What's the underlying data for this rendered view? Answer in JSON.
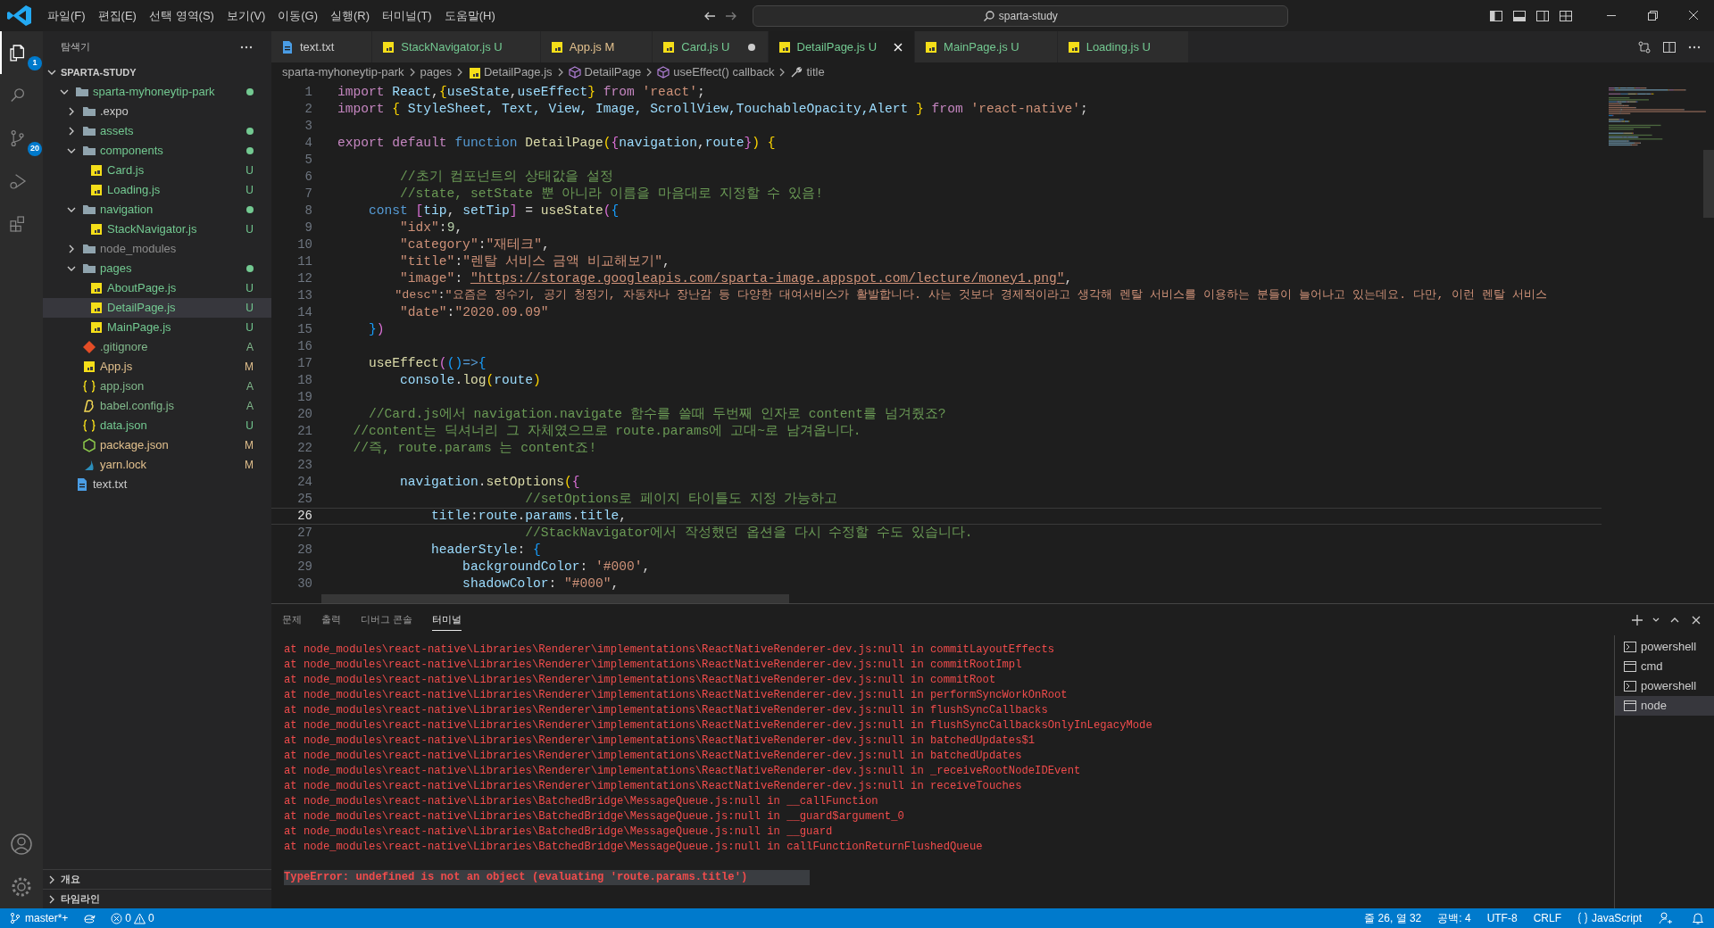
{
  "title_bar": {
    "menus": [
      "파일(F)",
      "편집(E)",
      "선택 영역(S)",
      "보기(V)",
      "이동(G)",
      "실행(R)",
      "터미널(T)",
      "도움말(H)"
    ],
    "search": "sparta-study"
  },
  "activity_bar": [
    {
      "kind": "explorer",
      "selected": true,
      "badge": "1"
    },
    {
      "kind": "search",
      "selected": false
    },
    {
      "kind": "scm",
      "selected": false,
      "badge": "20"
    },
    {
      "kind": "debug",
      "selected": false
    },
    {
      "kind": "extensions",
      "selected": false
    }
  ],
  "sidebar": {
    "title": "탐색기",
    "section": "SPARTA-STUDY",
    "tree": [
      {
        "name": "sparta-myhoneytip-park",
        "kind": "folder",
        "expanded": true,
        "color": "#73c991",
        "dot": true,
        "selected": false,
        "children": [
          {
            "name": ".expo",
            "kind": "folder",
            "expanded": false,
            "dot": false,
            "selected": false
          },
          {
            "name": "assets",
            "kind": "folder",
            "expanded": false,
            "color": "#73c991",
            "dot": true,
            "selected": false
          },
          {
            "name": "components",
            "kind": "folder",
            "expanded": true,
            "color": "#73c991",
            "dot": true,
            "selected": false,
            "children": [
              {
                "name": "Card.js",
                "kind": "js",
                "color": "#73c991",
                "status": "U",
                "selected": false
              },
              {
                "name": "Loading.js",
                "kind": "js",
                "color": "#73c991",
                "status": "U",
                "selected": false
              }
            ]
          },
          {
            "name": "navigation",
            "kind": "folder",
            "expanded": true,
            "color": "#73c991",
            "dot": true,
            "selected": false,
            "children": [
              {
                "name": "StackNavigator.js",
                "kind": "js",
                "color": "#73c991",
                "status": "U",
                "selected": false
              }
            ]
          },
          {
            "name": "node_modules",
            "kind": "folder",
            "expanded": false,
            "color": "#8c8c8c",
            "dot": false,
            "selected": false
          },
          {
            "name": "pages",
            "kind": "folder",
            "expanded": true,
            "color": "#73c991",
            "dot": true,
            "selected": false,
            "children": [
              {
                "name": "AboutPage.js",
                "kind": "js",
                "color": "#73c991",
                "status": "U",
                "selected": false
              },
              {
                "name": "DetailPage.js",
                "kind": "js",
                "color": "#73c991",
                "status": "U",
                "selected": true
              },
              {
                "name": "MainPage.js",
                "kind": "js",
                "color": "#73c991",
                "status": "U",
                "selected": false
              }
            ]
          },
          {
            "name": ".gitignore",
            "kind": "git",
            "color": "#81b88b",
            "status": "A",
            "selected": false
          },
          {
            "name": "App.js",
            "kind": "js",
            "color": "#e2c08d",
            "status": "M",
            "selected": false
          },
          {
            "name": "app.json",
            "kind": "json",
            "color": "#81b88b",
            "status": "A",
            "selected": false
          },
          {
            "name": "babel.config.js",
            "kind": "babel",
            "color": "#81b88b",
            "status": "A",
            "selected": false
          },
          {
            "name": "data.json",
            "kind": "json",
            "color": "#73c991",
            "status": "U",
            "selected": false
          },
          {
            "name": "package.json",
            "kind": "npm",
            "color": "#e2c08d",
            "status": "M",
            "selected": false
          },
          {
            "name": "yarn.lock",
            "kind": "yarn",
            "color": "#e2c08d",
            "status": "M",
            "selected": false
          }
        ]
      },
      {
        "name": "text.txt",
        "kind": "txt",
        "selected": false
      }
    ],
    "bottom_sections": [
      "개요",
      "타임라인"
    ]
  },
  "tabs": [
    {
      "label": "text.txt",
      "kind": "txt",
      "selected": false,
      "dirty": false
    },
    {
      "label": "StackNavigator.js",
      "kind": "js",
      "color": "#73c991",
      "status": "U",
      "selected": false,
      "dirty": false
    },
    {
      "label": "App.js",
      "kind": "js",
      "color": "#e2c08d",
      "status": "M",
      "selected": false,
      "dirty": false
    },
    {
      "label": "Card.js",
      "kind": "js",
      "color": "#73c991",
      "status": "U",
      "selected": false,
      "dirty": true
    },
    {
      "label": "DetailPage.js",
      "kind": "js",
      "color": "#73c991",
      "status": "U",
      "selected": true,
      "dirty": false
    },
    {
      "label": "MainPage.js",
      "kind": "js",
      "color": "#73c991",
      "status": "U",
      "selected": false,
      "dirty": false
    },
    {
      "label": "Loading.js",
      "kind": "js",
      "color": "#73c991",
      "status": "U",
      "selected": false,
      "dirty": false
    }
  ],
  "breadcrumb": [
    {
      "label": "sparta-myhoneytip-park",
      "kind": "folder"
    },
    {
      "label": "pages",
      "kind": "folder"
    },
    {
      "label": "DetailPage.js",
      "kind": "js"
    },
    {
      "label": "DetailPage",
      "kind": "symbol"
    },
    {
      "label": "useEffect() callback",
      "kind": "symbol"
    },
    {
      "label": "title",
      "kind": "property"
    }
  ],
  "editor": {
    "lines": [
      {
        "number": "1",
        "current": false,
        "segments": [
          {
            "text": "import ",
            "kind": "keyword"
          },
          {
            "text": "React",
            "kind": "variable"
          },
          {
            "text": ",",
            "kind": "punctuation"
          },
          {
            "text": "{",
            "kind": "bracket1"
          },
          {
            "text": "useState",
            "kind": "variable"
          },
          {
            "text": ",",
            "kind": "punctuation"
          },
          {
            "text": "useEffect",
            "kind": "variable"
          },
          {
            "text": "}",
            "kind": "bracket1"
          },
          {
            "text": " from ",
            "kind": "keyword"
          },
          {
            "text": "'react'",
            "kind": "string"
          },
          {
            "text": ";",
            "kind": "punctuation"
          }
        ]
      },
      {
        "number": "2",
        "current": false,
        "segments": [
          {
            "text": "import ",
            "kind": "keyword"
          },
          {
            "text": "{",
            "kind": "bracket1"
          },
          {
            "text": " StyleSheet, Text, View, Image, ScrollView,TouchableOpacity,Alert ",
            "kind": "variable"
          },
          {
            "text": "}",
            "kind": "bracket1"
          },
          {
            "text": " from ",
            "kind": "keyword"
          },
          {
            "text": "'react-native'",
            "kind": "string"
          },
          {
            "text": ";",
            "kind": "punctuation"
          }
        ]
      },
      {
        "number": "3",
        "current": false
      },
      {
        "number": "4",
        "current": false,
        "segments": [
          {
            "text": "export default ",
            "kind": "keyword"
          },
          {
            "text": "function ",
            "kind": "storage"
          },
          {
            "text": "DetailPage",
            "kind": "function"
          },
          {
            "text": "(",
            "kind": "bracket1"
          },
          {
            "text": "{",
            "kind": "bracket2"
          },
          {
            "text": "navigation",
            "kind": "variable"
          },
          {
            "text": ",",
            "kind": "punctuation"
          },
          {
            "text": "route",
            "kind": "variable"
          },
          {
            "text": "}",
            "kind": "bracket2"
          },
          {
            "text": ")",
            "kind": "bracket1"
          },
          {
            "text": " {",
            "kind": "bracket1"
          }
        ]
      },
      {
        "number": "5",
        "current": false
      },
      {
        "number": "6",
        "current": false,
        "segments": [
          {
            "text": "        //초기 컴포넌트의 상태값을 설정",
            "kind": "comment"
          }
        ]
      },
      {
        "number": "7",
        "current": false,
        "segments": [
          {
            "text": "        //state, setState 뿐 아니라 이름을 마음대로 지정할 수 있음!",
            "kind": "comment"
          }
        ]
      },
      {
        "number": "8",
        "current": false,
        "segments": [
          {
            "text": "    const ",
            "kind": "storage"
          },
          {
            "text": "[",
            "kind": "bracket2"
          },
          {
            "text": "tip",
            "kind": "variable"
          },
          {
            "text": ", ",
            "kind": "punctuation"
          },
          {
            "text": "setTip",
            "kind": "variable"
          },
          {
            "text": "]",
            "kind": "bracket2"
          },
          {
            "text": " = ",
            "kind": "punctuation"
          },
          {
            "text": "useState",
            "kind": "function"
          },
          {
            "text": "(",
            "kind": "bracket2"
          },
          {
            "text": "{",
            "kind": "bracket3"
          }
        ]
      },
      {
        "number": "9",
        "current": false,
        "segments": [
          {
            "text": "        \"idx\"",
            "kind": "string"
          },
          {
            "text": ":",
            "kind": "punctuation"
          },
          {
            "text": "9",
            "kind": "number"
          },
          {
            "text": ",",
            "kind": "punctuation"
          }
        ]
      },
      {
        "number": "10",
        "current": false,
        "segments": [
          {
            "text": "        \"category\"",
            "kind": "string"
          },
          {
            "text": ":",
            "kind": "punctuation"
          },
          {
            "text": "\"재테크\"",
            "kind": "string"
          },
          {
            "text": ",",
            "kind": "punctuation"
          }
        ]
      },
      {
        "number": "11",
        "current": false,
        "segments": [
          {
            "text": "        \"title\"",
            "kind": "string"
          },
          {
            "text": ":",
            "kind": "punctuation"
          },
          {
            "text": "\"렌탈 서비스 금액 비교해보기\"",
            "kind": "string"
          },
          {
            "text": ",",
            "kind": "punctuation"
          }
        ]
      },
      {
        "number": "12",
        "current": false,
        "segments": [
          {
            "text": "        \"image\"",
            "kind": "string"
          },
          {
            "text": ": ",
            "kind": "punctuation"
          },
          {
            "text": "\"https://storage.googleapis.com/sparta-image.appspot.com/lecture/money1.png\"",
            "kind": "link"
          },
          {
            "text": ",",
            "kind": "punctuation"
          }
        ]
      },
      {
        "number": "13",
        "current": false,
        "segments": [
          {
            "text": "        \"desc\"",
            "kind": "string"
          },
          {
            "text": ":",
            "kind": "punctuation"
          },
          {
            "text": "\"요즘은 정수기, 공기 청정기, 자동차나 장난감 등 다양한 대여서비스가 활발합니다. 사는 것보다 경제적이라고 생각해 렌탈 서비스를 이용하는 분들이 늘어나고 있는데요. 다만, 이런 렌탈 서비스",
            "kind": "string"
          }
        ]
      },
      {
        "number": "14",
        "current": false,
        "segments": [
          {
            "text": "        \"date\"",
            "kind": "string"
          },
          {
            "text": ":",
            "kind": "punctuation"
          },
          {
            "text": "\"2020.09.09\"",
            "kind": "string"
          }
        ]
      },
      {
        "number": "15",
        "current": false,
        "segments": [
          {
            "text": "    }",
            "kind": "bracket3"
          },
          {
            "text": ")",
            "kind": "bracket2"
          }
        ]
      },
      {
        "number": "16",
        "current": false
      },
      {
        "number": "17",
        "current": false,
        "segments": [
          {
            "text": "    useEffect",
            "kind": "function"
          },
          {
            "text": "(",
            "kind": "bracket2"
          },
          {
            "text": "()",
            "kind": "bracket3"
          },
          {
            "text": "=>",
            "kind": "storage"
          },
          {
            "text": "{",
            "kind": "bracket3"
          }
        ]
      },
      {
        "number": "18",
        "current": false,
        "segments": [
          {
            "text": "        console",
            "kind": "variable"
          },
          {
            "text": ".",
            "kind": "punctuation"
          },
          {
            "text": "log",
            "kind": "function"
          },
          {
            "text": "(",
            "kind": "bracket1"
          },
          {
            "text": "route",
            "kind": "variable"
          },
          {
            "text": ")",
            "kind": "bracket1"
          }
        ]
      },
      {
        "number": "19",
        "current": false
      },
      {
        "number": "20",
        "current": false,
        "segments": [
          {
            "text": "    //Card.js에서 navigation.navigate 함수를 쓸때 두번째 인자로 content를 넘겨줬죠?",
            "kind": "comment"
          }
        ]
      },
      {
        "number": "21",
        "current": false,
        "segments": [
          {
            "text": "  //content는 딕셔너리 그 자체였으므로 route.params에 고대~로 남겨옵니다.",
            "kind": "comment"
          }
        ]
      },
      {
        "number": "22",
        "current": false,
        "segments": [
          {
            "text": "  //즉, route.params 는 content죠!",
            "kind": "comment"
          }
        ]
      },
      {
        "number": "23",
        "current": false
      },
      {
        "number": "24",
        "current": false,
        "segments": [
          {
            "text": "        navigation",
            "kind": "variable"
          },
          {
            "text": ".",
            "kind": "punctuation"
          },
          {
            "text": "setOptions",
            "kind": "function"
          },
          {
            "text": "(",
            "kind": "bracket1"
          },
          {
            "text": "{",
            "kind": "bracket2"
          }
        ]
      },
      {
        "number": "25",
        "current": false,
        "segments": [
          {
            "text": "                        //setOptions로 페이지 타이틀도 지정 가능하고",
            "kind": "comment"
          }
        ]
      },
      {
        "number": "26",
        "current": true,
        "segments": [
          {
            "text": "            title",
            "kind": "variable"
          },
          {
            "text": ":",
            "kind": "punctuation"
          },
          {
            "text": "route",
            "kind": "variable"
          },
          {
            "text": ".",
            "kind": "punctuation"
          },
          {
            "text": "params",
            "kind": "variable"
          },
          {
            "text": ".",
            "kind": "punctuation"
          },
          {
            "text": "title",
            "kind": "variable"
          },
          {
            "text": ",",
            "kind": "punctuation"
          }
        ]
      },
      {
        "number": "27",
        "current": false,
        "segments": [
          {
            "text": "                        //StackNavigator에서 작성했던 옵션을 다시 수정할 수도 있습니다.",
            "kind": "comment"
          }
        ]
      },
      {
        "number": "28",
        "current": false,
        "segments": [
          {
            "text": "            headerStyle",
            "kind": "variable"
          },
          {
            "text": ": ",
            "kind": "punctuation"
          },
          {
            "text": "{",
            "kind": "bracket3"
          }
        ]
      },
      {
        "number": "29",
        "current": false,
        "segments": [
          {
            "text": "                backgroundColor",
            "kind": "variable"
          },
          {
            "text": ": ",
            "kind": "punctuation"
          },
          {
            "text": "'#000'",
            "kind": "string"
          },
          {
            "text": ",",
            "kind": "punctuation"
          }
        ]
      },
      {
        "number": "30",
        "current": false,
        "segments": [
          {
            "text": "                shadowColor",
            "kind": "variable"
          },
          {
            "text": ": ",
            "kind": "punctuation"
          },
          {
            "text": "\"#000\"",
            "kind": "string"
          },
          {
            "text": ",",
            "kind": "punctuation"
          }
        ]
      }
    ]
  },
  "panel": {
    "tabs": [
      {
        "label": "문제",
        "selected": false
      },
      {
        "label": "출력",
        "selected": false
      },
      {
        "label": "디버그 콘솔",
        "selected": false
      },
      {
        "label": "터미널",
        "selected": true
      }
    ],
    "terminal_lines": [
      {
        "kind": "trace",
        "text": "at node_modules\\react-native\\Libraries\\Renderer\\implementations\\ReactNativeRenderer-dev.js:null in commitLayoutEffects"
      },
      {
        "kind": "trace",
        "text": "at node_modules\\react-native\\Libraries\\Renderer\\implementations\\ReactNativeRenderer-dev.js:null in commitRootImpl"
      },
      {
        "kind": "trace",
        "text": "at node_modules\\react-native\\Libraries\\Renderer\\implementations\\ReactNativeRenderer-dev.js:null in commitRoot"
      },
      {
        "kind": "trace",
        "text": "at node_modules\\react-native\\Libraries\\Renderer\\implementations\\ReactNativeRenderer-dev.js:null in performSyncWorkOnRoot"
      },
      {
        "kind": "trace",
        "text": "at node_modules\\react-native\\Libraries\\Renderer\\implementations\\ReactNativeRenderer-dev.js:null in flushSyncCallbacks"
      },
      {
        "kind": "trace",
        "text": "at node_modules\\react-native\\Libraries\\Renderer\\implementations\\ReactNativeRenderer-dev.js:null in flushSyncCallbacksOnlyInLegacyMode"
      },
      {
        "kind": "trace",
        "text": "at node_modules\\react-native\\Libraries\\Renderer\\implementations\\ReactNativeRenderer-dev.js:null in batchedUpdates$1"
      },
      {
        "kind": "trace",
        "text": "at node_modules\\react-native\\Libraries\\Renderer\\implementations\\ReactNativeRenderer-dev.js:null in batchedUpdates"
      },
      {
        "kind": "trace",
        "text": "at node_modules\\react-native\\Libraries\\Renderer\\implementations\\ReactNativeRenderer-dev.js:null in _receiveRootNodeIDEvent"
      },
      {
        "kind": "trace",
        "text": "at node_modules\\react-native\\Libraries\\Renderer\\implementations\\ReactNativeRenderer-dev.js:null in receiveTouches"
      },
      {
        "kind": "trace",
        "text": "at node_modules\\react-native\\Libraries\\BatchedBridge\\MessageQueue.js:null in __callFunction"
      },
      {
        "kind": "trace",
        "text": "at node_modules\\react-native\\Libraries\\BatchedBridge\\MessageQueue.js:null in __guard$argument_0"
      },
      {
        "kind": "trace",
        "text": "at node_modules\\react-native\\Libraries\\BatchedBridge\\MessageQueue.js:null in __guard"
      },
      {
        "kind": "trace",
        "text": "at node_modules\\react-native\\Libraries\\BatchedBridge\\MessageQueue.js:null in callFunctionReturnFlushedQueue"
      },
      {
        "kind": "error",
        "text": "TypeError: undefined is not an object (evaluating 'route.params.title')"
      }
    ],
    "terminals": [
      {
        "label": "powershell",
        "kind": "shell",
        "selected": false
      },
      {
        "label": "cmd",
        "kind": "console",
        "selected": false
      },
      {
        "label": "powershell",
        "kind": "shell",
        "selected": false
      },
      {
        "label": "node",
        "kind": "console",
        "selected": true
      }
    ]
  },
  "status_bar": {
    "branch": "master*+",
    "errors": "0",
    "warnings": "0",
    "right": [
      "줄 26, 열 32",
      "공백: 4",
      "UTF-8",
      "CRLF",
      "JavaScript"
    ]
  }
}
